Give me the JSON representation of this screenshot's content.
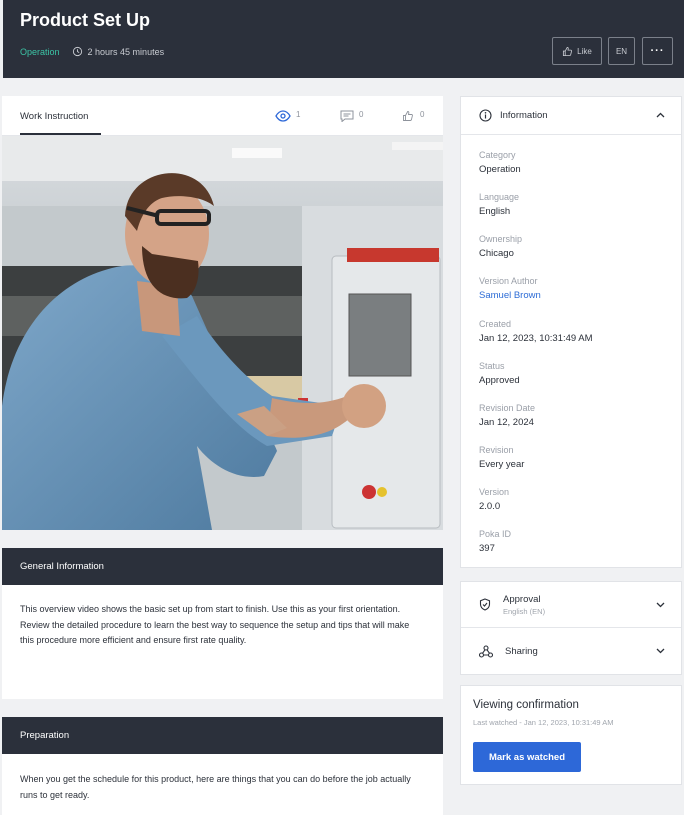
{
  "header": {
    "title": "Product Set Up",
    "category": "Operation",
    "duration": "2 hours  45 minutes",
    "like_label": "Like",
    "lang_label": "EN",
    "more_label": "···"
  },
  "tabs": {
    "work_instruction": "Work Instruction",
    "views": "1",
    "comments": "0",
    "likes": "0"
  },
  "general": {
    "title": "General Information",
    "text": "This overview video shows the basic set up from start to finish. Use this as your first orientation. Review the detailed procedure to learn the best way to sequence the setup and tips that will make this procedure more efficient and ensure first rate quality."
  },
  "preparation": {
    "title": "Preparation",
    "text": "When you get the schedule for this product, here are things that you can do before the job actually runs to get ready."
  },
  "information": {
    "title": "Information",
    "fields": [
      {
        "label": "Category",
        "value": "Operation"
      },
      {
        "label": "Language",
        "value": "English"
      },
      {
        "label": "Ownership",
        "value": "Chicago"
      },
      {
        "label": "Version Author",
        "value": "Samuel Brown"
      },
      {
        "label": "Created",
        "value": "Jan 12, 2023, 10:31:49 AM"
      },
      {
        "label": "Status",
        "value": "Approved"
      },
      {
        "label": "Revision Date",
        "value": "Jan 12, 2024"
      },
      {
        "label": "Revision",
        "value": "Every year"
      },
      {
        "label": "Version",
        "value": "2.0.0"
      },
      {
        "label": "Poka ID",
        "value": "397"
      }
    ]
  },
  "approval": {
    "title": "Approval",
    "subtitle": "English (EN)"
  },
  "sharing": {
    "title": "Sharing"
  },
  "viewing": {
    "title": "Viewing confirmation",
    "subtitle": "Last watched - Jan 12, 2023, 10:31:49 AM",
    "button": "Mark as watched"
  },
  "colors": {
    "header_bg": "#2b303b",
    "accent_green": "#3cc4a6",
    "primary_blue": "#2d68d8",
    "link_blue": "#2d6cd6"
  }
}
